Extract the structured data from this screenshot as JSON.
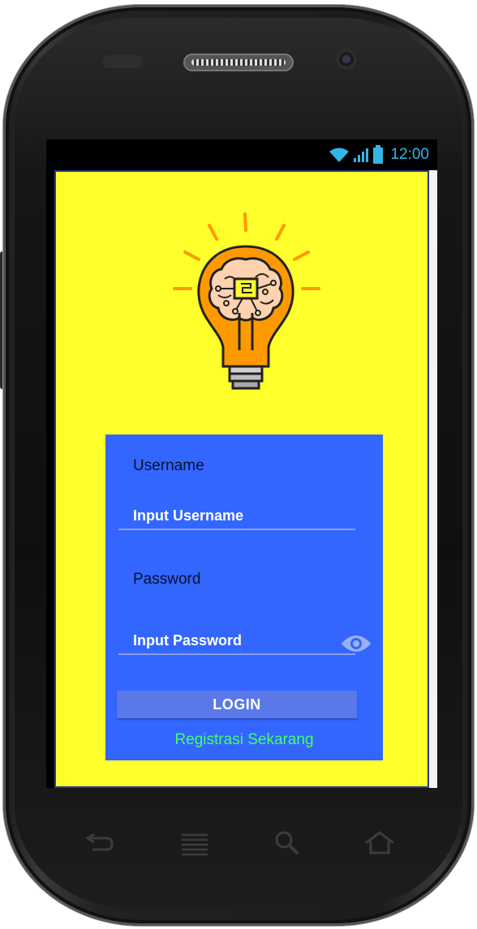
{
  "status_bar": {
    "time": "12:00",
    "icons": [
      "wifi-icon",
      "signal-icon",
      "battery-icon"
    ],
    "accent_color": "#33b5e5"
  },
  "app": {
    "background_color": "#ffff2c",
    "logo": "lightbulb-brain-icon"
  },
  "login_card": {
    "background_color": "#3366ff",
    "username_label": "Username",
    "username_placeholder": "Input Username",
    "password_label": "Password",
    "password_placeholder": "Input Password",
    "toggle_visibility_icon": "eye-icon",
    "login_button": "LOGIN",
    "register_link": "Registrasi Sekarang",
    "register_color": "#44ff66"
  },
  "nav_keys": [
    "back-icon",
    "menu-icon",
    "search-icon",
    "home-icon"
  ]
}
